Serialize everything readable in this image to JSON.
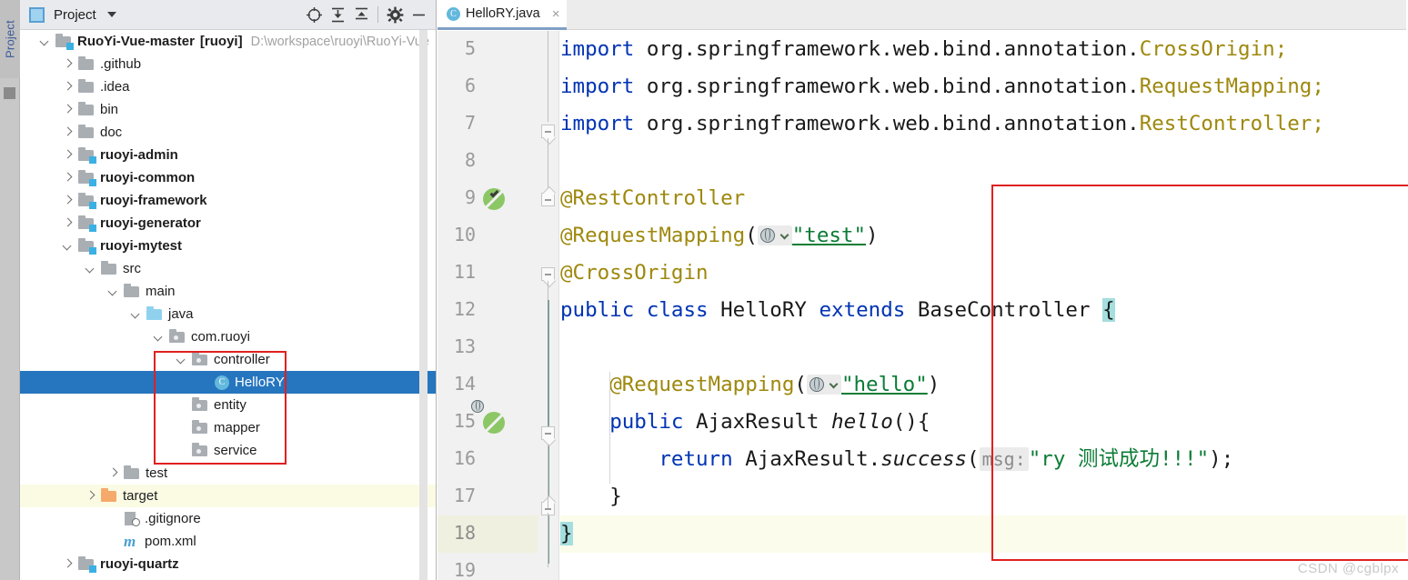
{
  "ide": {
    "left_tool_tab": "Project",
    "watermark": "CSDN @cgblpx"
  },
  "project_panel": {
    "toolbar": {
      "title": "Project",
      "icons": [
        {
          "name": "locate-icon",
          "glyph": "locate"
        },
        {
          "name": "expand-all-icon",
          "glyph": "expand"
        },
        {
          "name": "collapse-all-icon",
          "glyph": "collapse"
        },
        {
          "name": "settings-gear-icon",
          "glyph": "gear"
        },
        {
          "name": "hide-panel-icon",
          "glyph": "minus"
        }
      ]
    },
    "tree": [
      {
        "label": "RuoYi-Vue-master",
        "suffix": "[ruoyi]",
        "path": "D:\\workspace\\ruoyi\\RuoYi-Vue",
        "depth": 0,
        "arrow": "down",
        "icon": "module-folder",
        "bold": true
      },
      {
        "label": ".github",
        "depth": 1,
        "arrow": "right",
        "icon": "folder"
      },
      {
        "label": ".idea",
        "depth": 1,
        "arrow": "right",
        "icon": "folder"
      },
      {
        "label": "bin",
        "depth": 1,
        "arrow": "right",
        "icon": "folder"
      },
      {
        "label": "doc",
        "depth": 1,
        "arrow": "right",
        "icon": "folder"
      },
      {
        "label": "ruoyi-admin",
        "depth": 1,
        "arrow": "right",
        "icon": "module-folder",
        "bold": true
      },
      {
        "label": "ruoyi-common",
        "depth": 1,
        "arrow": "right",
        "icon": "module-folder",
        "bold": true
      },
      {
        "label": "ruoyi-framework",
        "depth": 1,
        "arrow": "right",
        "icon": "module-folder",
        "bold": true
      },
      {
        "label": "ruoyi-generator",
        "depth": 1,
        "arrow": "right",
        "icon": "module-folder",
        "bold": true
      },
      {
        "label": "ruoyi-mytest",
        "depth": 1,
        "arrow": "down",
        "icon": "module-folder",
        "bold": true
      },
      {
        "label": "src",
        "depth": 2,
        "arrow": "down",
        "icon": "folder"
      },
      {
        "label": "main",
        "depth": 3,
        "arrow": "down",
        "icon": "folder"
      },
      {
        "label": "java",
        "depth": 4,
        "arrow": "down",
        "icon": "source-folder"
      },
      {
        "label": "com.ruoyi",
        "depth": 5,
        "arrow": "down",
        "icon": "package"
      },
      {
        "label": "controller",
        "depth": 6,
        "arrow": "down",
        "icon": "package"
      },
      {
        "label": "HelloRY",
        "depth": 7,
        "arrow": "none",
        "icon": "java-class",
        "selected": true
      },
      {
        "label": "entity",
        "depth": 6,
        "arrow": "none",
        "icon": "package"
      },
      {
        "label": "mapper",
        "depth": 6,
        "arrow": "none",
        "icon": "package"
      },
      {
        "label": "service",
        "depth": 6,
        "arrow": "none",
        "icon": "package"
      },
      {
        "label": "test",
        "depth": 3,
        "arrow": "right",
        "icon": "folder"
      },
      {
        "label": "target",
        "depth": 2,
        "arrow": "right",
        "icon": "excluded-folder",
        "highlight": true
      },
      {
        "label": ".gitignore",
        "depth": 3,
        "arrow": "none",
        "icon": "gitignore-file"
      },
      {
        "label": "pom.xml",
        "depth": 3,
        "arrow": "none",
        "icon": "maven-file"
      },
      {
        "label": "ruoyi-quartz",
        "depth": 1,
        "arrow": "right",
        "icon": "module-folder",
        "bold": true
      }
    ],
    "annotation_color": "#e02020"
  },
  "editor": {
    "tab": {
      "filename": "HelloRY.java",
      "close_label": "×"
    },
    "annotation_color": "#e02020",
    "line_numbers": [
      "5",
      "6",
      "7",
      "8",
      "9",
      "10",
      "11",
      "12",
      "13",
      "14",
      "15",
      "16",
      "17",
      "18",
      "19"
    ],
    "caret_line": "18",
    "gutter_icons": [
      {
        "line": "9",
        "name": "spring-bean-gutter-icon"
      },
      {
        "line": "15",
        "name": "spring-request-mapping-gutter-icon"
      }
    ],
    "lines": [
      {
        "num": "5",
        "text": "import org.springframework.web.bind.annotation.CrossOrigin;"
      },
      {
        "num": "6",
        "text": "import org.springframework.web.bind.annotation.RequestMapping;"
      },
      {
        "num": "7",
        "text": "import org.springframework.web.bind.annotation.RestController;"
      },
      {
        "num": "8",
        "text": ""
      },
      {
        "num": "9",
        "text": "@RestController"
      },
      {
        "num": "10",
        "text": "@RequestMapping(\"test\")"
      },
      {
        "num": "11",
        "text": "@CrossOrigin"
      },
      {
        "num": "12",
        "text": "public class HelloRY extends BaseController {"
      },
      {
        "num": "13",
        "text": ""
      },
      {
        "num": "14",
        "text": "    @RequestMapping(\"hello\")"
      },
      {
        "num": "15",
        "text": "    public AjaxResult hello(){"
      },
      {
        "num": "16",
        "text": "        return AjaxResult.success( msg: \"ry 测试成功!!!\");"
      },
      {
        "num": "17",
        "text": "    }"
      },
      {
        "num": "18",
        "text": "}"
      }
    ],
    "tokens": {
      "kw_import": "import",
      "kw_public": "public",
      "kw_class": "class",
      "kw_extends": "extends",
      "kw_return": "return",
      "pkg_prefix": " org.springframework.web.bind.annotation.",
      "type_cross_origin": "CrossOrigin;",
      "type_request_mapping": "RequestMapping;",
      "type_rest_controller": "RestController;",
      "ann_rest_controller": "@RestController",
      "ann_request_mapping": "@RequestMapping",
      "ann_cross_origin": "@CrossOrigin",
      "class_name": "HelloRY",
      "super_class": "BaseController",
      "ret_type": "AjaxResult",
      "method_name": "hello",
      "static_call_obj": "AjaxResult",
      "static_call_mth": "success",
      "param_hint": "msg:",
      "str_test": "\"test\"",
      "str_hello": "\"hello\"",
      "str_msg": "\"ry 测试成功!!!\"",
      "open_paren": "(",
      "close_paren": ")",
      "open_brace": "{",
      "close_brace": "}",
      "semicolon": ";",
      "paren_pair": "()",
      "brace_open_after_paren": "{",
      "indent4": "    ",
      "indent8": "        "
    }
  }
}
